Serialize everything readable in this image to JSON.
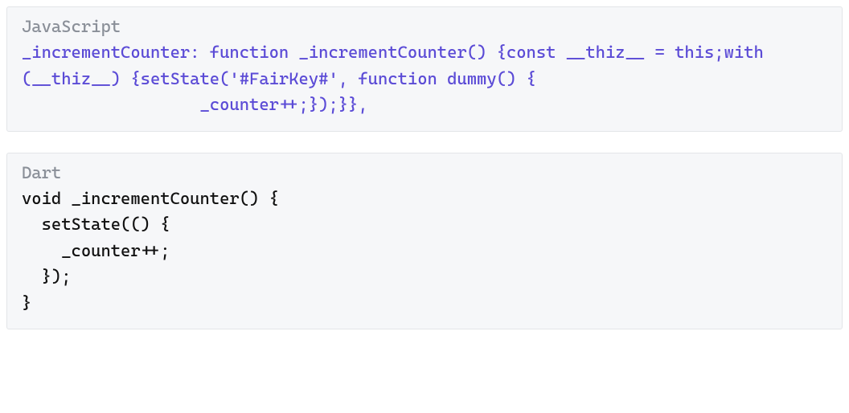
{
  "blocks": [
    {
      "lang": "JavaScript",
      "lines": [
        {
          "cls": "purple",
          "text": "_incrementCounter: function _incrementCounter() {const __thiz__ = this;with (__thiz__) {setState('#FairKey#', function dummy() {"
        },
        {
          "cls": "purple",
          "text": "                  _counter++;});}},"
        }
      ]
    },
    {
      "lang": "Dart",
      "lines": [
        {
          "cls": "plain",
          "text": "void _incrementCounter() {"
        },
        {
          "cls": "plain",
          "text": "  setState(() {"
        },
        {
          "cls": "plain",
          "text": "    _counter++;"
        },
        {
          "cls": "plain",
          "text": "  });"
        },
        {
          "cls": "plain",
          "text": "}"
        }
      ]
    }
  ]
}
